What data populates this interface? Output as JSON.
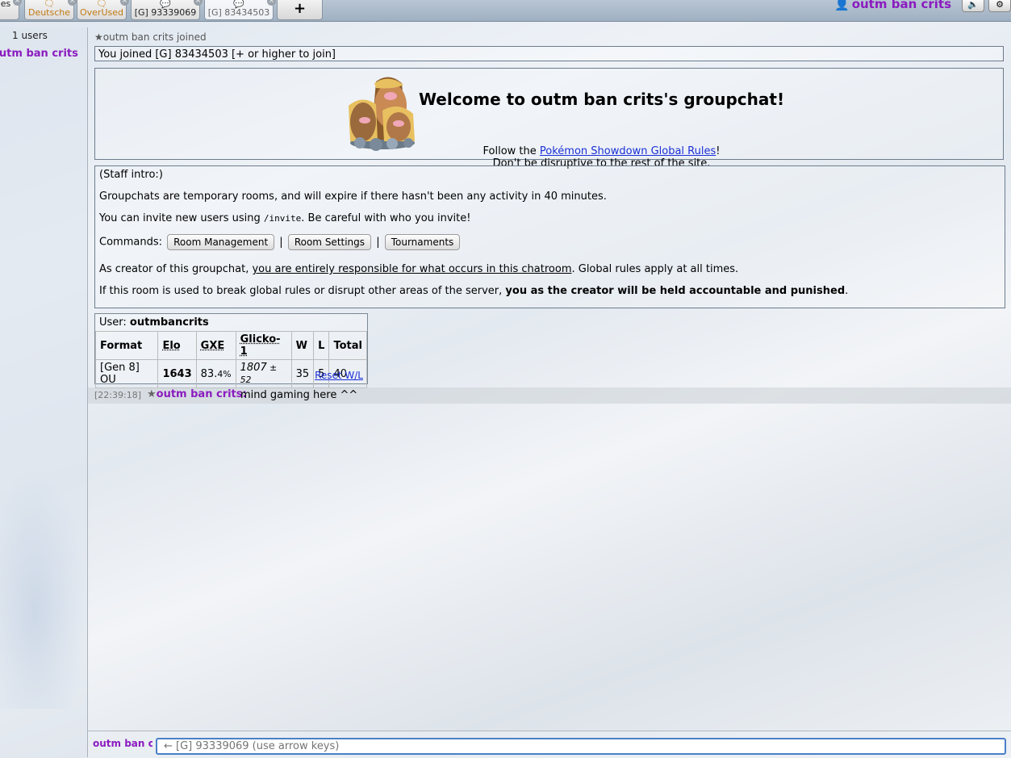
{
  "tabs": {
    "partial_label": "es",
    "deutsche": "Deutsche",
    "overused": "OverUsed",
    "g1": "[G] 93339069",
    "g2": "[G] 83434503",
    "plus": "+"
  },
  "header": {
    "username": "outm ban crits"
  },
  "userlist": {
    "count": "1 users",
    "user": "outm ban crits"
  },
  "chat": {
    "joined_note": "outm ban crits joined",
    "joined_box": "You joined [G] 83434503 [+ or higher to join]",
    "welcome": {
      "title": "Welcome to outm ban crits's groupchat!",
      "follow_prefix": "Follow the ",
      "rules_link": "Pokémon Showdown Global Rules",
      "follow_suffix": "!",
      "line2": "Don't be disruptive to the rest of the site."
    },
    "staff": {
      "intro": "(Staff intro:)",
      "expire": "Groupchats are temporary rooms, and will expire if there hasn't been any activity in 40 minutes.",
      "invite_prefix": "You can invite new users using ",
      "invite_cmd": "/invite",
      "invite_suffix": ". Be careful with who you invite!",
      "commands_label": "Commands:",
      "btn_room_mgmt": "Room Management",
      "btn_room_settings": "Room Settings",
      "btn_tournaments": "Tournaments",
      "sep": "|",
      "creator_prefix": "As creator of this groupchat, ",
      "creator_underlined": "you are entirely responsible for what occurs in this chatroom",
      "creator_suffix": ". Global rules apply at all times.",
      "punish_prefix": "If this room is used to break global rules or disrupt other areas of the server, ",
      "punish_bold": "you as the creator will be held accountable and punished",
      "punish_suffix": "."
    },
    "stats": {
      "user_label": "User: ",
      "user_name": "outmbancrits",
      "headers": [
        "Format",
        "Elo",
        "GXE",
        "Glicko-1",
        "W",
        "L",
        "Total"
      ],
      "row": {
        "format": "[Gen 8] OU",
        "elo": "1643",
        "gxe": "83.",
        "gxe_small": "4%",
        "glicko": "1807",
        "glicko_dev": " ± 52",
        "w": "35",
        "l": "5",
        "total": "40"
      },
      "reset": "Reset W/L"
    },
    "message": {
      "time": "[22:39:18]",
      "user": "outm ban crits:",
      "text": "mind gaming here ^^"
    }
  },
  "composer": {
    "me": "outm ban c",
    "placeholder": "← [G] 93339069 (use arrow keys)"
  }
}
